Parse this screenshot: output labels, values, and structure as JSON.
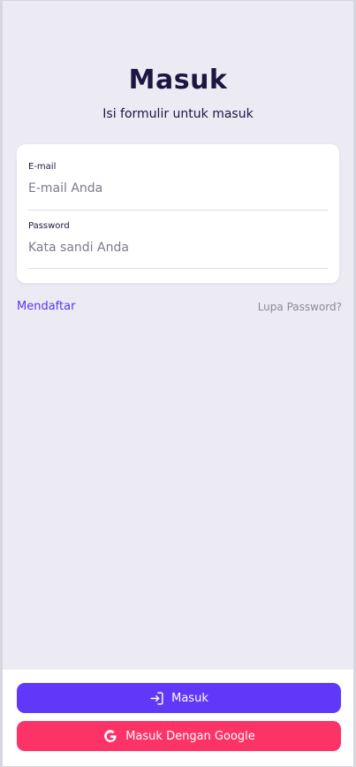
{
  "header": {
    "title": "Masuk",
    "subtitle": "Isi formulir untuk masuk"
  },
  "form": {
    "email": {
      "label": "E-mail",
      "placeholder": "E-mail Anda",
      "value": ""
    },
    "password": {
      "label": "Password",
      "placeholder": "Kata sandi Anda",
      "value": ""
    }
  },
  "links": {
    "register": "Mendaftar",
    "forgot_password": "Lupa Password?"
  },
  "actions": {
    "login": {
      "label": "Masuk",
      "icon": "login-icon"
    },
    "google_login": {
      "label": "Masuk Dengan Google",
      "icon": "google-icon"
    }
  },
  "colors": {
    "background": "#ecebf4",
    "primary": "#5f38fa",
    "google": "#fc3367",
    "link": "#5a33f0",
    "text": "#1d1640",
    "muted": "#8b8c96"
  }
}
